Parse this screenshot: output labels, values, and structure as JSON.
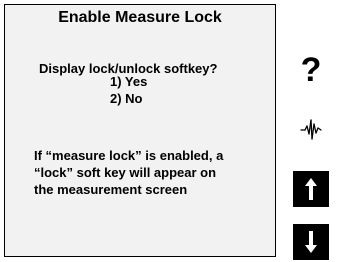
{
  "screen": {
    "title": "Enable Measure Lock",
    "question": "Display lock/unlock softkey?",
    "options": [
      {
        "label": "1) Yes"
      },
      {
        "label": "2) No"
      }
    ],
    "info_lines": [
      "If “measure lock” is enabled, a",
      "“lock” soft key will appear on",
      "the measurement screen"
    ]
  },
  "softkeys": {
    "help": {
      "glyph": "?",
      "icon": "help-icon"
    },
    "measure": {
      "icon": "measure-icon"
    },
    "up": {
      "icon": "arrow-up-icon"
    },
    "down": {
      "icon": "arrow-down-icon"
    }
  }
}
